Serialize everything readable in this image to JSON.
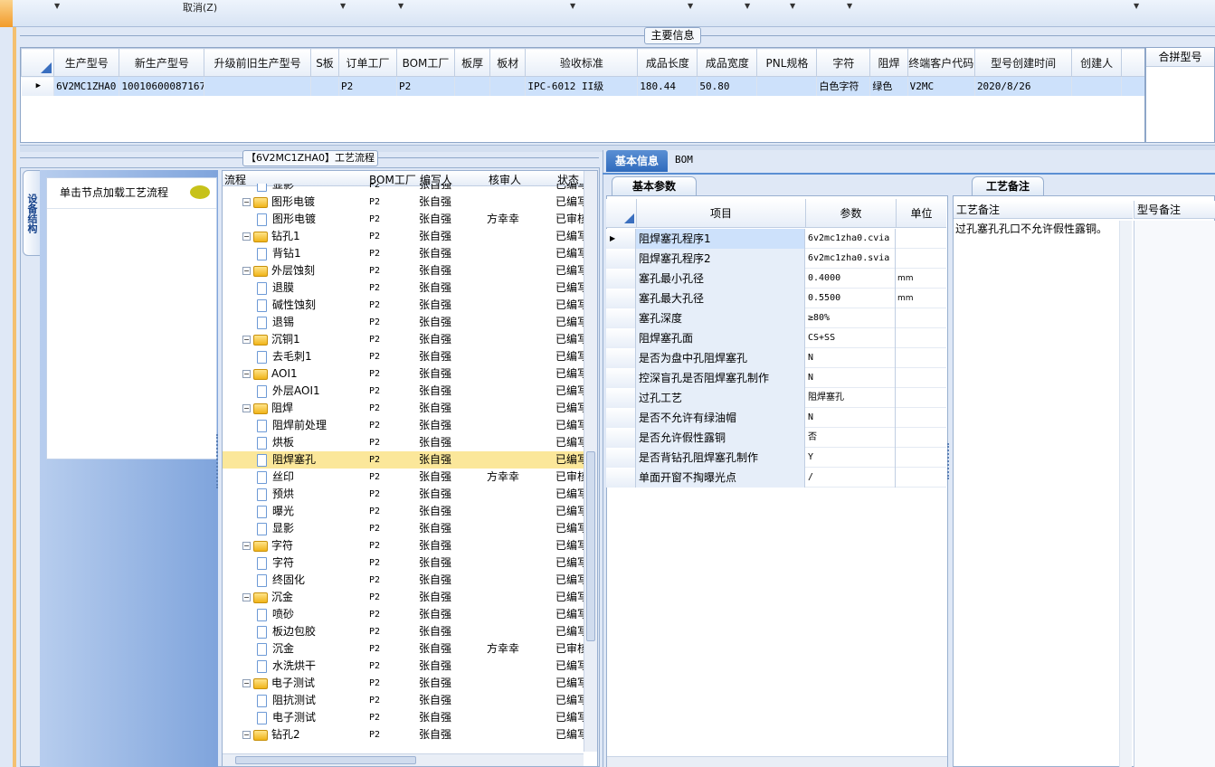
{
  "toolbar": {
    "cancel_label": "取消(Z)"
  },
  "main_info": {
    "title": "主要信息",
    "columns": [
      "生产型号",
      "新生产型号",
      "升级前旧生产型号",
      "S板",
      "订单工厂",
      "BOM工厂",
      "板厚",
      "板材",
      "验收标准",
      "成品长度",
      "成品宽度",
      "PNL规格",
      "字符",
      "阻焊",
      "终端客户代码",
      "型号创建时间",
      "创建人"
    ],
    "row": [
      "6V2MC1ZHA0",
      "10010600087167",
      "",
      "",
      "P2",
      "P2",
      "",
      "",
      "IPC-6012 II级",
      "180.44",
      "50.80",
      "",
      "白色字符",
      "绿色",
      "V2MC",
      "2020/8/26",
      ""
    ],
    "merge_header": "合拼型号"
  },
  "flow": {
    "title": "【6V2MC1ZHA0】工艺流程",
    "side_tab": "设备结构",
    "load_hint": "单击节点加载工艺流程",
    "headers": [
      "流程",
      "BOM工厂",
      "编写人",
      "核审人",
      "状态"
    ],
    "rows": [
      {
        "level": 2,
        "type": "doc",
        "name": "显影",
        "bom": "P2",
        "writer": "张自强",
        "checker": "",
        "status": "已编写"
      },
      {
        "level": 1,
        "type": "folder",
        "name": "图形电镀",
        "bom": "P2",
        "writer": "张自强",
        "checker": "",
        "status": "已编写"
      },
      {
        "level": 2,
        "type": "doc",
        "name": "图形电镀",
        "bom": "P2",
        "writer": "张自强",
        "checker": "方幸幸",
        "status": "已审核"
      },
      {
        "level": 1,
        "type": "folder",
        "name": "钻孔1",
        "bom": "P2",
        "writer": "张自强",
        "checker": "",
        "status": "已编写"
      },
      {
        "level": 2,
        "type": "doc",
        "name": "背钻1",
        "bom": "P2",
        "writer": "张自强",
        "checker": "",
        "status": "已编写"
      },
      {
        "level": 1,
        "type": "folder",
        "name": "外层蚀刻",
        "bom": "P2",
        "writer": "张自强",
        "checker": "",
        "status": "已编写"
      },
      {
        "level": 2,
        "type": "doc",
        "name": "退膜",
        "bom": "P2",
        "writer": "张自强",
        "checker": "",
        "status": "已编写"
      },
      {
        "level": 2,
        "type": "doc",
        "name": "碱性蚀刻",
        "bom": "P2",
        "writer": "张自强",
        "checker": "",
        "status": "已编写"
      },
      {
        "level": 2,
        "type": "doc",
        "name": "退锡",
        "bom": "P2",
        "writer": "张自强",
        "checker": "",
        "status": "已编写"
      },
      {
        "level": 1,
        "type": "folder",
        "name": "沉铜1",
        "bom": "P2",
        "writer": "张自强",
        "checker": "",
        "status": "已编写"
      },
      {
        "level": 2,
        "type": "doc",
        "name": "去毛刺1",
        "bom": "P2",
        "writer": "张自强",
        "checker": "",
        "status": "已编写"
      },
      {
        "level": 1,
        "type": "folder",
        "name": "AOI1",
        "bom": "P2",
        "writer": "张自强",
        "checker": "",
        "status": "已编写"
      },
      {
        "level": 2,
        "type": "doc",
        "name": "外层AOI1",
        "bom": "P2",
        "writer": "张自强",
        "checker": "",
        "status": "已编写"
      },
      {
        "level": 1,
        "type": "folder",
        "name": "阻焊",
        "bom": "P2",
        "writer": "张自强",
        "checker": "",
        "status": "已编写"
      },
      {
        "level": 2,
        "type": "doc",
        "name": "阻焊前处理",
        "bom": "P2",
        "writer": "张自强",
        "checker": "",
        "status": "已编写"
      },
      {
        "level": 2,
        "type": "doc",
        "name": "烘板",
        "bom": "P2",
        "writer": "张自强",
        "checker": "",
        "status": "已编写"
      },
      {
        "level": 2,
        "type": "doc",
        "name": "阻焊塞孔",
        "bom": "P2",
        "writer": "张自强",
        "checker": "",
        "status": "已编写",
        "selected": true
      },
      {
        "level": 2,
        "type": "doc",
        "name": "丝印",
        "bom": "P2",
        "writer": "张自强",
        "checker": "方幸幸",
        "status": "已审核"
      },
      {
        "level": 2,
        "type": "doc",
        "name": "预烘",
        "bom": "P2",
        "writer": "张自强",
        "checker": "",
        "status": "已编写"
      },
      {
        "level": 2,
        "type": "doc",
        "name": "曝光",
        "bom": "P2",
        "writer": "张自强",
        "checker": "",
        "status": "已编写"
      },
      {
        "level": 2,
        "type": "doc",
        "name": "显影",
        "bom": "P2",
        "writer": "张自强",
        "checker": "",
        "status": "已编写"
      },
      {
        "level": 1,
        "type": "folder",
        "name": "字符",
        "bom": "P2",
        "writer": "张自强",
        "checker": "",
        "status": "已编写"
      },
      {
        "level": 2,
        "type": "doc",
        "name": "字符",
        "bom": "P2",
        "writer": "张自强",
        "checker": "",
        "status": "已编写"
      },
      {
        "level": 2,
        "type": "doc",
        "name": "终固化",
        "bom": "P2",
        "writer": "张自强",
        "checker": "",
        "status": "已编写"
      },
      {
        "level": 1,
        "type": "folder",
        "name": "沉金",
        "bom": "P2",
        "writer": "张自强",
        "checker": "",
        "status": "已编写"
      },
      {
        "level": 2,
        "type": "doc",
        "name": "喷砂",
        "bom": "P2",
        "writer": "张自强",
        "checker": "",
        "status": "已编写"
      },
      {
        "level": 2,
        "type": "doc",
        "name": "板边包胶",
        "bom": "P2",
        "writer": "张自强",
        "checker": "",
        "status": "已编写"
      },
      {
        "level": 2,
        "type": "doc",
        "name": "沉金",
        "bom": "P2",
        "writer": "张自强",
        "checker": "方幸幸",
        "status": "已审核"
      },
      {
        "level": 2,
        "type": "doc",
        "name": "水洗烘干",
        "bom": "P2",
        "writer": "张自强",
        "checker": "",
        "status": "已编写"
      },
      {
        "level": 1,
        "type": "folder",
        "name": "电子测试",
        "bom": "P2",
        "writer": "张自强",
        "checker": "",
        "status": "已编写"
      },
      {
        "level": 2,
        "type": "doc",
        "name": "阻抗测试",
        "bom": "P2",
        "writer": "张自强",
        "checker": "",
        "status": "已编写"
      },
      {
        "level": 2,
        "type": "doc",
        "name": "电子测试",
        "bom": "P2",
        "writer": "张自强",
        "checker": "",
        "status": "已编写"
      },
      {
        "level": 1,
        "type": "folder",
        "name": "钻孔2",
        "bom": "P2",
        "writer": "张自强",
        "checker": "",
        "status": "已编写"
      }
    ]
  },
  "info_tabs": {
    "basic": "基本信息",
    "bom": "BOM"
  },
  "params": {
    "tab": "基本参数",
    "headers": [
      "项目",
      "参数",
      "单位"
    ],
    "rows": [
      {
        "item": "阻焊塞孔程序1",
        "value": "6v2mc1zha0.cvia",
        "unit": ""
      },
      {
        "item": "阻焊塞孔程序2",
        "value": "6v2mc1zha0.svia",
        "unit": ""
      },
      {
        "item": "塞孔最小孔径",
        "value": "0.4000",
        "unit": "mm"
      },
      {
        "item": "塞孔最大孔径",
        "value": "0.5500",
        "unit": "mm"
      },
      {
        "item": "塞孔深度",
        "value": "≥80%",
        "unit": ""
      },
      {
        "item": "阻焊塞孔面",
        "value": "CS+SS",
        "unit": ""
      },
      {
        "item": "是否为盘中孔阻焊塞孔",
        "value": "N",
        "unit": ""
      },
      {
        "item": "控深盲孔是否阻焊塞孔制作",
        "value": "N",
        "unit": ""
      },
      {
        "item": "过孔工艺",
        "value": "阻焊塞孔",
        "unit": ""
      },
      {
        "item": "是否不允许有绿油帽",
        "value": "N",
        "unit": ""
      },
      {
        "item": "是否允许假性露铜",
        "value": "否",
        "unit": ""
      },
      {
        "item": "是否背钻孔阻焊塞孔制作",
        "value": "Y",
        "unit": ""
      },
      {
        "item": "单面开窗不掏曝光点",
        "value": "/",
        "unit": ""
      }
    ]
  },
  "notes": {
    "tab": "工艺备注",
    "col1": "工艺备注",
    "col2": "型号备注",
    "text": "过孔塞孔孔口不允许假性露铜。"
  }
}
